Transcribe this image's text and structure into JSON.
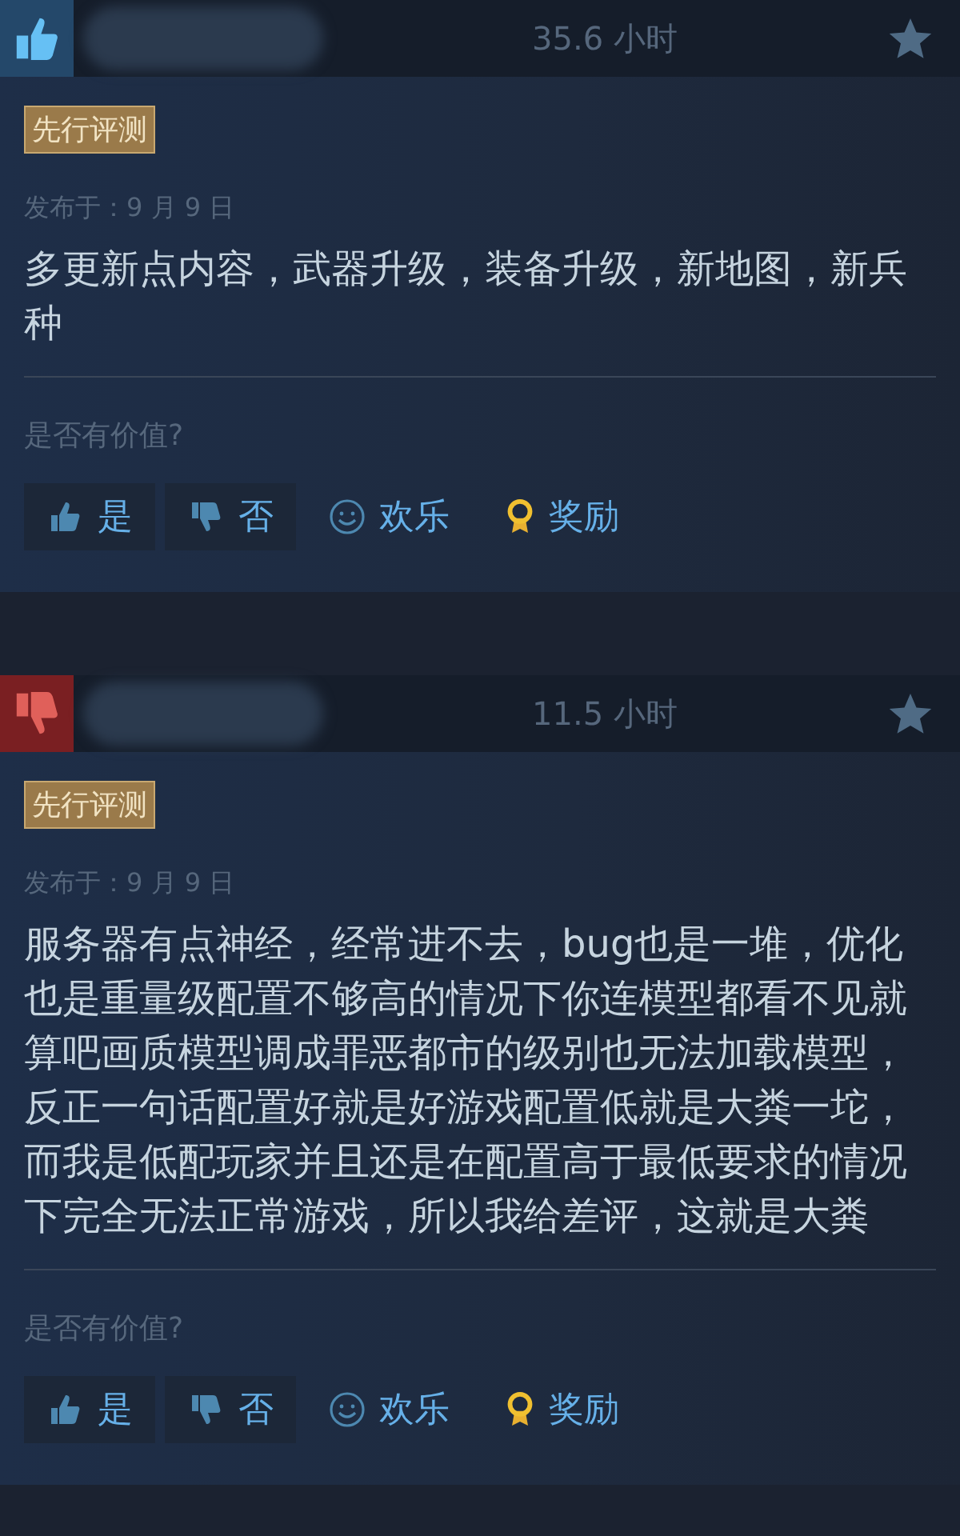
{
  "reviews": [
    {
      "recommended": true,
      "hours": "35.6 小时",
      "badge": "先行评测",
      "posted": "发布于：9 月 9 日",
      "text": "多更新点内容，武器升级，装备升级，新地图，新兵种",
      "question": "是否有价值?",
      "actions": [
        {
          "kind": "yes",
          "label": "是"
        },
        {
          "kind": "no",
          "label": "否"
        },
        {
          "kind": "funny",
          "label": "欢乐"
        },
        {
          "kind": "award",
          "label": "奖励"
        }
      ]
    },
    {
      "recommended": false,
      "hours": "11.5 小时",
      "badge": "先行评测",
      "posted": "发布于：9 月 9 日",
      "text": "服务器有点神经，经常进不去，bug也是一堆，优化也是重量级配置不够高的情况下你连模型都看不见就算吧画质模型调成罪恶都市的级别也无法加载模型，反正一句话配置好就是好游戏配置低就是大粪一坨，而我是低配玩家并且还是在配置高于最低要求的情况下完全无法正常游戏，所以我给差评，这就是大粪",
      "question": "是否有价值?",
      "actions": [
        {
          "kind": "yes",
          "label": "是"
        },
        {
          "kind": "no",
          "label": "否"
        },
        {
          "kind": "funny",
          "label": "欢乐"
        },
        {
          "kind": "award",
          "label": "奖励"
        }
      ]
    }
  ]
}
